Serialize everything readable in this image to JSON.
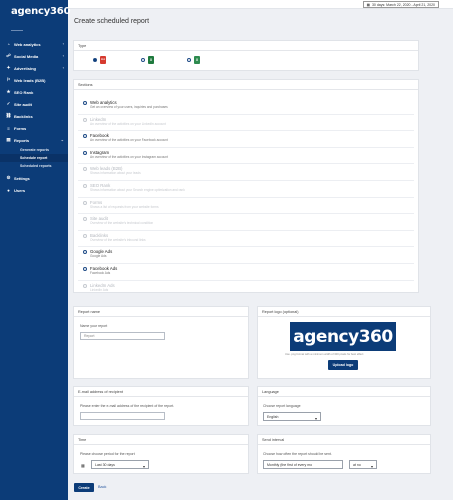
{
  "app": {
    "logo": "agency360",
    "logo_tagline": "———",
    "date_range": "30 days: March 22, 2020 - April 21, 2020",
    "date_icon": "calendar-icon"
  },
  "sidebar": {
    "items": [
      {
        "label": "Web analytics",
        "icon": "chart-icon",
        "glyph": "◔",
        "chevron": true
      },
      {
        "label": "Social Media",
        "icon": "share-icon",
        "glyph": "☍",
        "chevron": true
      },
      {
        "label": "Advertising",
        "icon": "megaphone-icon",
        "glyph": "✦",
        "chevron": true
      },
      {
        "label": "Web leads (B2B)",
        "icon": "leads-icon",
        "glyph": "⚐",
        "chevron": false
      },
      {
        "label": "SEO Rank",
        "icon": "rank-icon",
        "glyph": "★",
        "chevron": false
      },
      {
        "label": "Site audit",
        "icon": "audit-icon",
        "glyph": "✓",
        "chevron": false
      },
      {
        "label": "Backlinks",
        "icon": "link-icon",
        "glyph": "⛓",
        "chevron": false
      },
      {
        "label": "Forms",
        "icon": "form-icon",
        "glyph": "≡",
        "chevron": false
      },
      {
        "label": "Reports",
        "icon": "report-icon",
        "glyph": "▤",
        "chevron": true
      }
    ],
    "subitems": [
      "Generate reports",
      "Schedule report",
      "Scheduled reports"
    ],
    "bottom": [
      {
        "label": "Settings",
        "icon": "gear-icon",
        "glyph": "⚙"
      },
      {
        "label": "Users",
        "icon": "user-icon",
        "glyph": "●"
      }
    ]
  },
  "page": {
    "title": "Create scheduled report"
  },
  "type_card": {
    "title": "Type",
    "options": [
      {
        "icon": "pdf-file-icon",
        "glyph": "PDF",
        "color": "#d63a2f",
        "selected": true
      },
      {
        "icon": "excel-file-icon",
        "glyph": "X",
        "color": "#1f7a3e",
        "selected": false
      },
      {
        "icon": "excel-file-icon",
        "glyph": "X",
        "color": "#2e8b4f",
        "selected": false
      }
    ]
  },
  "sections_card": {
    "title": "Sections",
    "items": [
      {
        "name": "Web analytics",
        "desc": "Get an overview of your users, inquiries and purchases",
        "enabled": true
      },
      {
        "name": "LinkedIn",
        "desc": "An overview of the activities on your LinkedIn account",
        "enabled": false
      },
      {
        "name": "Facebook",
        "desc": "An overview of the activities on your Facebook account",
        "enabled": true
      },
      {
        "name": "Instagram",
        "desc": "An overview of the activities on your Instagram account",
        "enabled": true
      },
      {
        "name": "Web leads (B2B)",
        "desc": "Shows information about your leads",
        "enabled": false
      },
      {
        "name": "SEO Rank",
        "desc": "Shows information about your Search engine optimization and rank",
        "enabled": false
      },
      {
        "name": "Forms",
        "desc": "Shows a list of requests from your website forms",
        "enabled": false
      },
      {
        "name": "Site audit",
        "desc": "Overview of the website's technical condition",
        "enabled": false
      },
      {
        "name": "Backlinks",
        "desc": "Overview of the website's inbound links",
        "enabled": false
      },
      {
        "name": "Google Ads",
        "desc": "Google Ads",
        "enabled": true
      },
      {
        "name": "Facebook Ads",
        "desc": "Facebook Ads",
        "enabled": true
      },
      {
        "name": "LinkedIn Ads",
        "desc": "LinkedIn Ads",
        "enabled": false
      }
    ]
  },
  "report_name": {
    "title": "Report name",
    "label": "Name your report",
    "placeholder": "Report"
  },
  "report_logo": {
    "title": "Report logo (optional)",
    "logo_text": "agency360",
    "hint": "Use .png format with a minimum width of 300 pixels for best effect",
    "button": "Upload logo"
  },
  "email": {
    "title": "E-mail address of recipient",
    "label": "Please enter the e-mail address of the recipient of the report.",
    "value": ""
  },
  "language": {
    "title": "Language",
    "label": "Choose report language",
    "value": "English"
  },
  "time": {
    "title": "Time",
    "label": "Please choose period for the report",
    "value": "Last 30 days"
  },
  "interval": {
    "title": "Send interval",
    "label": "Choose how often the report should be sent.",
    "value": "Monthly (the first of every mo",
    "time_value": "at no"
  },
  "actions": {
    "create": "Create",
    "back": "Back"
  }
}
